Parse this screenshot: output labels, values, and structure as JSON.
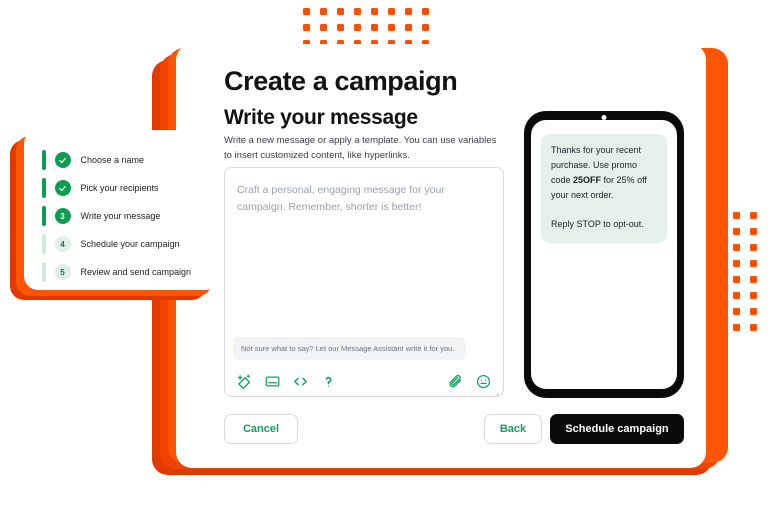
{
  "theme": {
    "accent_green": "#0d9c52",
    "accent_orange": "#ff5500",
    "orange_dark": "#e03a00",
    "bubble_bg": "#e4f1ea",
    "submit_bg": "#0a0a0a"
  },
  "card": {
    "page_title": "Create a campaign",
    "section_title": "Write your message",
    "section_description": "Write a new message or apply a template. You can use variables to insert customized content, like hyperlinks."
  },
  "composer": {
    "placeholder": "Craft a personal, engaging message for your campaign. Remember, shorter is better!",
    "value": "",
    "assistant_hint": "Not sure what to say? Let our Message Assistant write it for you.",
    "toolbar_left": [
      {
        "icon": "magic-wand-icon",
        "label": "Message Assistant"
      },
      {
        "icon": "template-icon",
        "label": "Apply template"
      },
      {
        "icon": "code-brackets-icon",
        "label": "Insert variable"
      },
      {
        "icon": "question-mark-icon",
        "label": "Help"
      }
    ],
    "toolbar_right": [
      {
        "icon": "paperclip-icon",
        "label": "Attach file"
      },
      {
        "icon": "emoji-icon",
        "label": "Insert emoji"
      }
    ]
  },
  "phone_preview": {
    "message_line_1_a": "Thanks for your recent purchase. Use promo code ",
    "message_line_1_bold": "25OFF",
    "message_line_1_b": " for 25% off your next order.",
    "message_line_2": "Reply STOP to opt-out."
  },
  "footer": {
    "cancel_label": "Cancel",
    "back_label": "Back",
    "submit_label": "Schedule campaign"
  },
  "steps": {
    "items": [
      {
        "number": "1",
        "label": "Choose a name",
        "state": "done"
      },
      {
        "number": "2",
        "label": "Pick your recipients",
        "state": "done"
      },
      {
        "number": "3",
        "label": "Write your message",
        "state": "current"
      },
      {
        "number": "4",
        "label": "Schedule your campaign",
        "state": "todo"
      },
      {
        "number": "5",
        "label": "Review and send campaign",
        "state": "todo"
      }
    ]
  },
  "decor": {
    "dots_top": {
      "cols": 8,
      "rows": 3
    },
    "dots_right": {
      "cols": 3,
      "rows": 8
    }
  }
}
